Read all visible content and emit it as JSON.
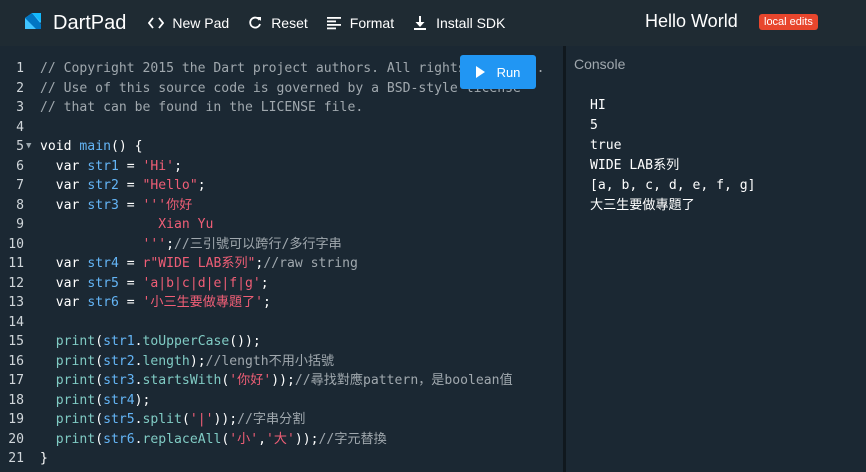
{
  "app": {
    "name": "DartPad"
  },
  "nav": {
    "new_pad": "New Pad",
    "reset": "Reset",
    "format": "Format",
    "install_sdk": "Install SDK"
  },
  "header": {
    "title": "Hello World",
    "badge": "local edits"
  },
  "run": {
    "label": "Run"
  },
  "console": {
    "label": "Console",
    "output": [
      "HI",
      "5",
      "true",
      "WIDE LAB系列",
      "[a, b, c, d, e, f, g]",
      "大三生要做專題了"
    ]
  },
  "editor": {
    "line_numbers": [
      "1",
      "2",
      "3",
      "4",
      "5",
      "6",
      "7",
      "8",
      "9",
      "10",
      "11",
      "12",
      "13",
      "14",
      "15",
      "16",
      "17",
      "18",
      "19",
      "20",
      "21"
    ],
    "lines": [
      [
        {
          "t": "// Copyright 2015 the Dart project authors. All rights reserved.",
          "c": "comment"
        }
      ],
      [
        {
          "t": "// Use of this source code is governed by a BSD-style license",
          "c": "comment"
        }
      ],
      [
        {
          "t": "// that can be found in the LICENSE file.",
          "c": "comment"
        }
      ],
      [],
      [
        {
          "t": "void ",
          "c": "kw"
        },
        {
          "t": "main",
          "c": "var"
        },
        {
          "t": "() {",
          "c": "kw"
        }
      ],
      [
        {
          "t": "  var ",
          "c": "kw"
        },
        {
          "t": "str1",
          "c": "var"
        },
        {
          "t": " = ",
          "c": "kw"
        },
        {
          "t": "'Hi'",
          "c": "str"
        },
        {
          "t": ";",
          "c": "kw"
        }
      ],
      [
        {
          "t": "  var ",
          "c": "kw"
        },
        {
          "t": "str2",
          "c": "var"
        },
        {
          "t": " = ",
          "c": "kw"
        },
        {
          "t": "\"Hello\"",
          "c": "str"
        },
        {
          "t": ";",
          "c": "kw"
        }
      ],
      [
        {
          "t": "  var ",
          "c": "kw"
        },
        {
          "t": "str3",
          "c": "var"
        },
        {
          "t": " = ",
          "c": "kw"
        },
        {
          "t": "'''你好",
          "c": "str"
        }
      ],
      [
        {
          "t": "               Xian Yu",
          "c": "str"
        }
      ],
      [
        {
          "t": "             '''",
          "c": "str"
        },
        {
          "t": ";",
          "c": "kw"
        },
        {
          "t": "//三引號可以跨行/多行字串",
          "c": "comment"
        }
      ],
      [
        {
          "t": "  var ",
          "c": "kw"
        },
        {
          "t": "str4",
          "c": "var"
        },
        {
          "t": " = ",
          "c": "kw"
        },
        {
          "t": "r\"WIDE LAB系列\"",
          "c": "str"
        },
        {
          "t": ";",
          "c": "kw"
        },
        {
          "t": "//raw string",
          "c": "comment"
        }
      ],
      [
        {
          "t": "  var ",
          "c": "kw"
        },
        {
          "t": "str5",
          "c": "var"
        },
        {
          "t": " = ",
          "c": "kw"
        },
        {
          "t": "'a|b|c|d|e|f|g'",
          "c": "str"
        },
        {
          "t": ";",
          "c": "kw"
        }
      ],
      [
        {
          "t": "  var ",
          "c": "kw"
        },
        {
          "t": "str6",
          "c": "var"
        },
        {
          "t": " = ",
          "c": "kw"
        },
        {
          "t": "'小三生要做專題了'",
          "c": "str"
        },
        {
          "t": ";",
          "c": "kw"
        }
      ],
      [],
      [
        {
          "t": "  print",
          "c": "fn"
        },
        {
          "t": "(",
          "c": "kw"
        },
        {
          "t": "str1",
          "c": "var"
        },
        {
          "t": ".",
          "c": "kw"
        },
        {
          "t": "toUpperCase",
          "c": "fn"
        },
        {
          "t": "());",
          "c": "kw"
        }
      ],
      [
        {
          "t": "  print",
          "c": "fn"
        },
        {
          "t": "(",
          "c": "kw"
        },
        {
          "t": "str2",
          "c": "var"
        },
        {
          "t": ".",
          "c": "kw"
        },
        {
          "t": "length",
          "c": "fn"
        },
        {
          "t": ");",
          "c": "kw"
        },
        {
          "t": "//length不用小括號",
          "c": "comment"
        }
      ],
      [
        {
          "t": "  print",
          "c": "fn"
        },
        {
          "t": "(",
          "c": "kw"
        },
        {
          "t": "str3",
          "c": "var"
        },
        {
          "t": ".",
          "c": "kw"
        },
        {
          "t": "startsWith",
          "c": "fn"
        },
        {
          "t": "(",
          "c": "kw"
        },
        {
          "t": "'你好'",
          "c": "str"
        },
        {
          "t": "));",
          "c": "kw"
        },
        {
          "t": "//尋找對應pattern，是boolean值",
          "c": "comment"
        }
      ],
      [
        {
          "t": "  print",
          "c": "fn"
        },
        {
          "t": "(",
          "c": "kw"
        },
        {
          "t": "str4",
          "c": "var"
        },
        {
          "t": ");",
          "c": "kw"
        }
      ],
      [
        {
          "t": "  print",
          "c": "fn"
        },
        {
          "t": "(",
          "c": "kw"
        },
        {
          "t": "str5",
          "c": "var"
        },
        {
          "t": ".",
          "c": "kw"
        },
        {
          "t": "split",
          "c": "fn"
        },
        {
          "t": "(",
          "c": "kw"
        },
        {
          "t": "'|'",
          "c": "str"
        },
        {
          "t": "));",
          "c": "kw"
        },
        {
          "t": "//字串分割",
          "c": "comment"
        }
      ],
      [
        {
          "t": "  print",
          "c": "fn"
        },
        {
          "t": "(",
          "c": "kw"
        },
        {
          "t": "str6",
          "c": "var"
        },
        {
          "t": ".",
          "c": "kw"
        },
        {
          "t": "replaceAll",
          "c": "fn"
        },
        {
          "t": "(",
          "c": "kw"
        },
        {
          "t": "'小'",
          "c": "str"
        },
        {
          "t": ",",
          "c": "kw"
        },
        {
          "t": "'大'",
          "c": "str"
        },
        {
          "t": "));",
          "c": "kw"
        },
        {
          "t": "//字元替換",
          "c": "comment"
        }
      ],
      [
        {
          "t": "}",
          "c": "kw"
        }
      ]
    ],
    "fold_marker": "▼"
  },
  "colors": {
    "accent": "#2196f3",
    "badge": "#e8462d",
    "string": "#ef5e76",
    "variable": "#64b5f6",
    "function": "#80cbc4",
    "comment": "#a0a8ae"
  },
  "icons": {
    "logo": "dart-logo-icon",
    "new_pad": "code-brackets-icon",
    "reset": "refresh-icon",
    "format": "align-lines-icon",
    "install_sdk": "download-icon",
    "run": "play-icon"
  }
}
